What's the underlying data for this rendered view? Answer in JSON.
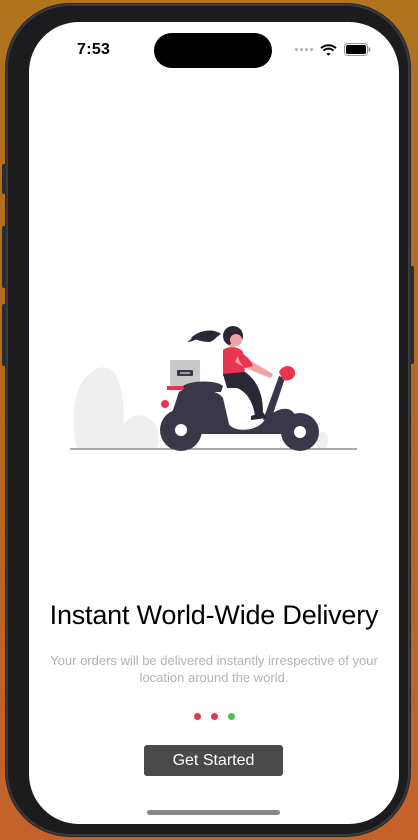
{
  "status_bar": {
    "time": "7:53",
    "icons": [
      "cellular-signal-icon",
      "wifi-icon",
      "battery-icon"
    ]
  },
  "onboarding": {
    "illustration": "delivery-scooter-illustration",
    "title": "Instant World-Wide Delivery",
    "subtitle": "Your orders will be delivered instantly irrespective of your location around the world.",
    "page_indicator": {
      "count": 3,
      "active_index": 2,
      "inactive_color": "#e03a52",
      "active_color": "#4cc24c"
    },
    "cta_label": "Get Started"
  },
  "colors": {
    "accent": "#e8344e",
    "dark": "#3a3748",
    "button_bg": "#4a4a4a"
  }
}
